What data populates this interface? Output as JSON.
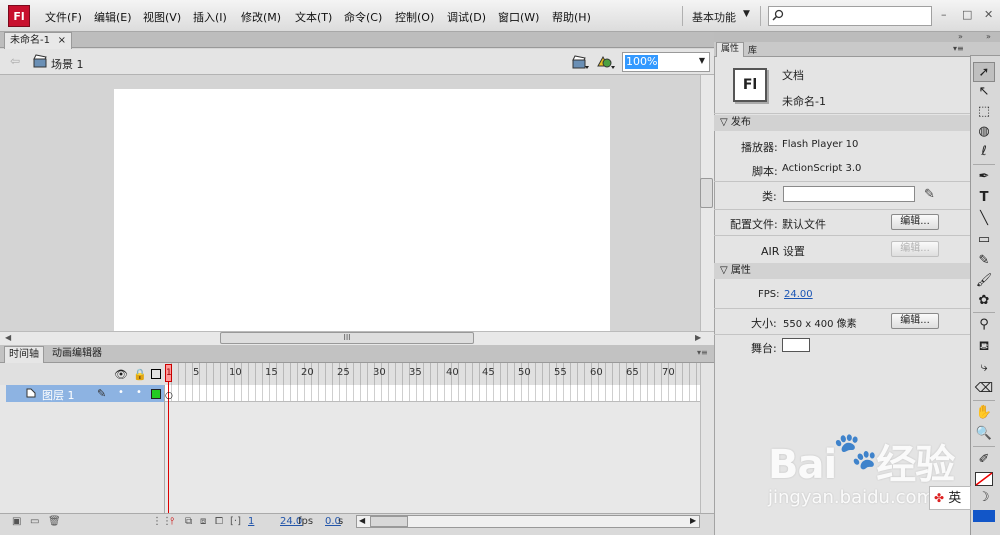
{
  "app": {
    "logo": "Fl"
  },
  "menu": [
    "文件(F)",
    "编辑(E)",
    "视图(V)",
    "插入(I)",
    "修改(M)",
    "文本(T)",
    "命令(C)",
    "控制(O)",
    "调试(D)",
    "窗口(W)",
    "帮助(H)"
  ],
  "workspace": {
    "label": "基本功能",
    "arrow": "▼"
  },
  "search": {
    "placeholder": ""
  },
  "window_controls": {
    "minimize": "–",
    "restore": "□",
    "close": "✕"
  },
  "document": {
    "tab_label": "未命名-1",
    "tab_close": "×"
  },
  "editbar": {
    "back_arrow": "⇦",
    "scene": "场景 1",
    "zoom": "100%",
    "zoom_arrow": "▼"
  },
  "stage": {
    "color": "#ffffff",
    "scroll_grip": "III"
  },
  "timeline": {
    "tabs": [
      "时间轴",
      "动画编辑器"
    ],
    "ruler": [
      "1",
      "5",
      "10",
      "15",
      "20",
      "25",
      "30",
      "35",
      "40",
      "45",
      "50",
      "55",
      "60",
      "65",
      "70"
    ],
    "layer_name": "图层 1",
    "current_frame": "1",
    "fps": "24.0",
    "fps_unit": "fps",
    "time": "0.0",
    "time_unit": "s"
  },
  "properties": {
    "tabs": [
      "属性",
      "库"
    ],
    "doc_icon": "Fl",
    "doc_type": "文档",
    "doc_name": "未命名-1",
    "publish_header": "发布",
    "player_label": "播放器:",
    "player_value": "Flash Player 10",
    "script_label": "脚本:",
    "script_value": "ActionScript 3.0",
    "class_label": "类:",
    "class_value": "",
    "profile_label": "配置文件:",
    "profile_value": "默认文件",
    "edit_button": "编辑...",
    "air_label": "AIR 设置",
    "props_header": "属性",
    "fps_label": "FPS:",
    "fps_value": "24.00",
    "size_label": "大小:",
    "size_value": "550 x 400 像素",
    "stage_label": "舞台:"
  },
  "colors": {
    "fill": "#1256c8",
    "layer_highlight": "#8db3e2",
    "accent": "#c8102e"
  },
  "watermark": {
    "logo": "Bai",
    "logo2": "经验",
    "url": "jingyan.baidu.com"
  },
  "ime": {
    "label": "英"
  }
}
